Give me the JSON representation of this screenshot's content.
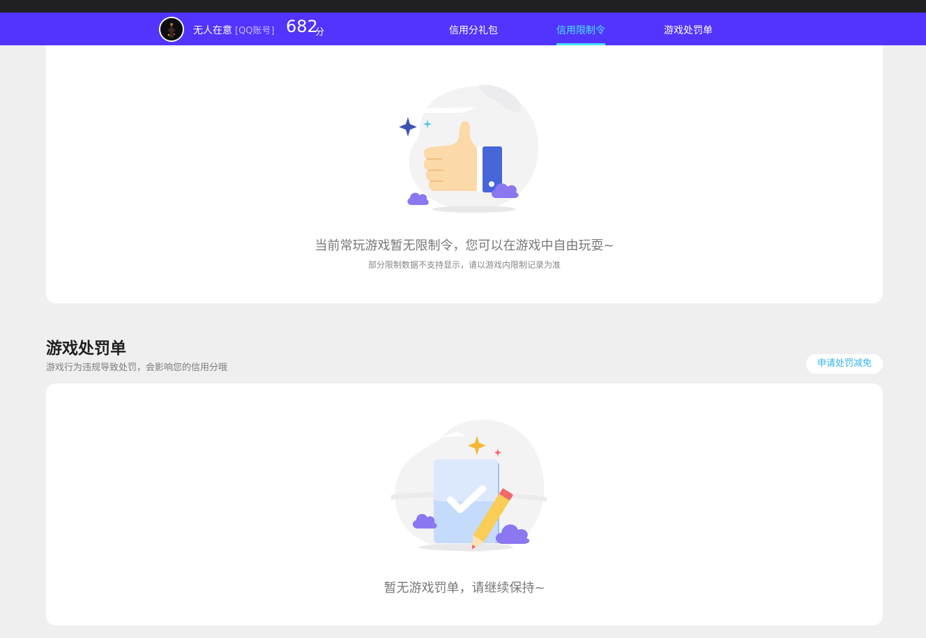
{
  "header": {
    "username": "无人在意",
    "account_type": "[QQ账号]",
    "score": "682",
    "score_unit": "分",
    "tabs": [
      {
        "label": "信用分礼包",
        "active": false
      },
      {
        "label": "信用限制令",
        "active": true
      },
      {
        "label": "游戏处罚单",
        "active": false
      }
    ]
  },
  "restriction": {
    "main_text": "当前常玩游戏暂无限制令，您可以在游戏中自由玩耍~",
    "sub_text": "部分限制数据不支持显示，请以游戏内限制记录为准"
  },
  "penalty": {
    "title": "游戏处罚单",
    "subtitle": "游戏行为违规导致处罚，会影响您的信用分哦",
    "appeal_button": "申请处罚减免",
    "empty_text": "暂无游戏罚单，请继续保持~"
  },
  "colors": {
    "nav_bg": "#5134fd",
    "active_tab": "#4be3ff",
    "appeal_text": "#2fb4e8",
    "page_bg": "#efefef"
  },
  "icons": [
    "thumbs-up-illustration",
    "document-check-illustration",
    "sparkle-icon",
    "cloud-icon"
  ]
}
